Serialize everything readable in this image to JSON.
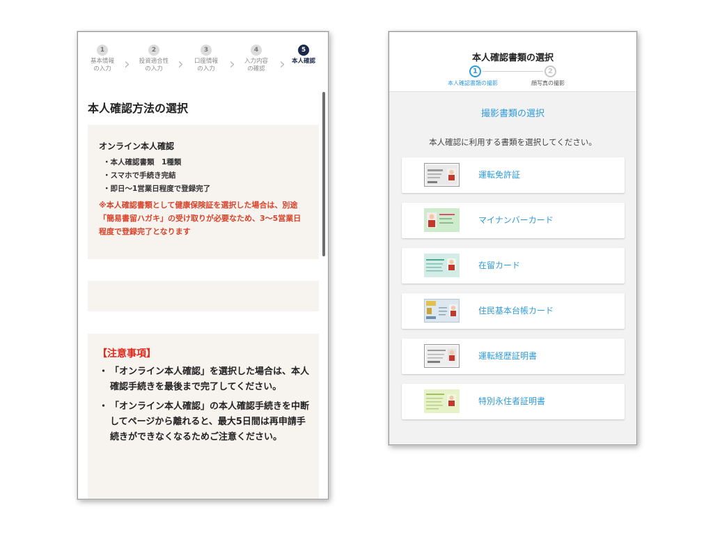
{
  "left": {
    "steps": [
      {
        "num": "1",
        "label": "基本情報\nの入力",
        "active": false
      },
      {
        "num": "2",
        "label": "投資適合性\nの入力",
        "active": false
      },
      {
        "num": "3",
        "label": "口座情報\nの入力",
        "active": false
      },
      {
        "num": "4",
        "label": "入力内容\nの確認",
        "active": false
      },
      {
        "num": "5",
        "label": "本人確認",
        "active": true
      }
    ],
    "page_title": "本人確認方法の選択",
    "option": {
      "title": "オンライン本人確認",
      "bullets": [
        "・本人確認書類　1種類",
        "・スマホで手続き完結",
        "・即日〜1営業日程度で登録完了"
      ],
      "warning": "※本人確認書類として健康保険証を選択した場合は、別途「簡易書留ハガキ」の受け取りが必要なため、3〜5営業日程度で登録完了となります"
    },
    "notice": {
      "title": "【注意事項】",
      "items": [
        "「オンライン本人確認」を選択した場合は、本人確認手続きを最後まで完了してください。",
        "「オンライン本人確認」の本人確認手続きを中断してページから離れると、最大5日間は再申請手続きができなくなるためご注意ください。"
      ]
    }
  },
  "right": {
    "title": "本人確認書類の選択",
    "steps": [
      {
        "num": "1",
        "label": "本人確認書類の撮影"
      },
      {
        "num": "2",
        "label": "顔写真の撮影"
      }
    ],
    "section_title": "撮影書類の選択",
    "instruction": "本人確認に利用する書類を選択してください。",
    "documents": [
      {
        "label": "運転免許証",
        "icon": "drivers-license-icon",
        "color": "#e9e9e9"
      },
      {
        "label": "マイナンバーカード",
        "icon": "my-number-card-icon",
        "color": "#cdeccc"
      },
      {
        "label": "在留カード",
        "icon": "residence-card-icon",
        "color": "#d3ece6"
      },
      {
        "label": "住民基本台帳カード",
        "icon": "resident-register-card-icon",
        "color": "#dce7ef"
      },
      {
        "label": "運転経歴証明書",
        "icon": "driving-record-certificate-icon",
        "color": "#eeeeee"
      },
      {
        "label": "特別永住者証明書",
        "icon": "special-permanent-resident-icon",
        "color": "#e8f2c8"
      }
    ]
  },
  "colors": {
    "accent_blue": "#2f9bd8",
    "warning_red": "#d8432a",
    "notice_red": "#e0281b",
    "active_step_navy": "#1b2a4a",
    "box_beige": "#f7f3ef"
  }
}
